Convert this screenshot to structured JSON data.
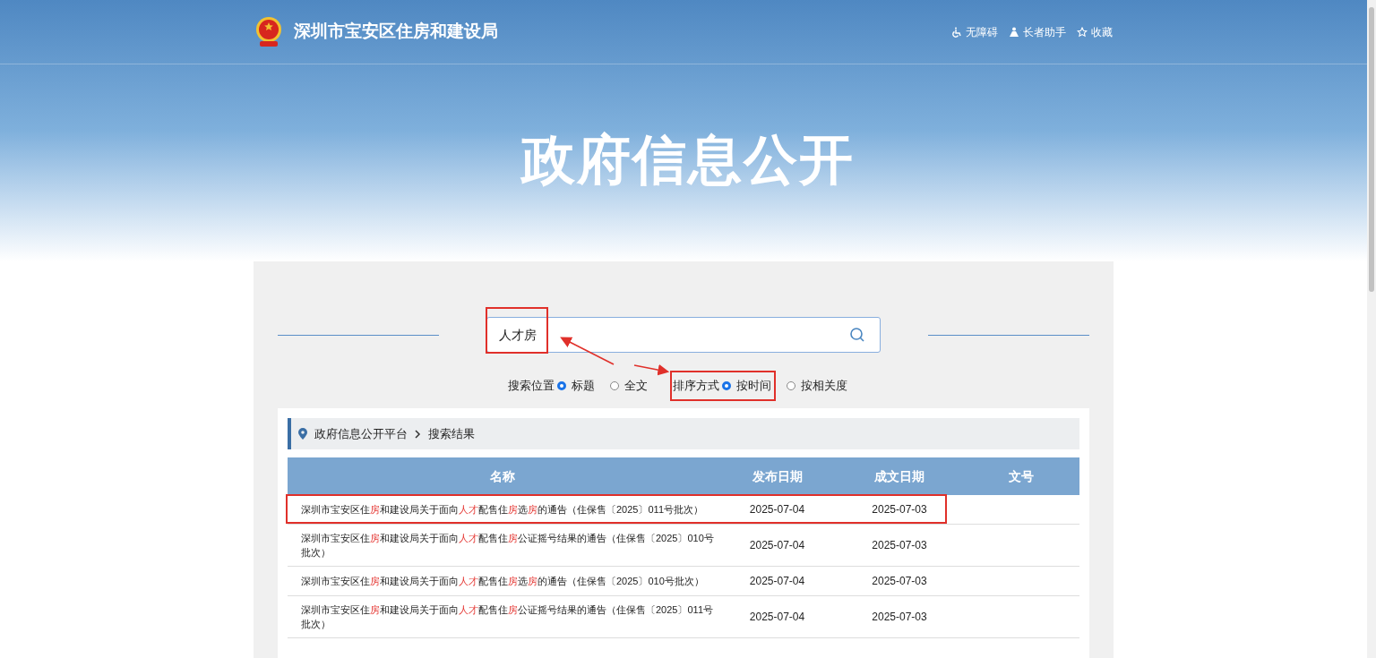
{
  "header": {
    "site_title": "深圳市宝安区住房和建设局",
    "links": [
      {
        "kind": "accessibility",
        "label": "无障碍"
      },
      {
        "kind": "elder",
        "label": "长者助手"
      },
      {
        "kind": "favorite",
        "label": "收藏"
      }
    ]
  },
  "banner": {
    "title": "政府信息公开"
  },
  "search": {
    "value": "人才房",
    "marked": true
  },
  "filters": [
    {
      "label": "搜索位置",
      "marked": false,
      "options": [
        {
          "label": "标题",
          "selected": true
        },
        {
          "label": "全文",
          "selected": false
        }
      ]
    },
    {
      "label": "排序方式",
      "marked": true,
      "options": [
        {
          "label": "按时间",
          "selected": true
        },
        {
          "label": "按相关度",
          "selected": false
        }
      ]
    }
  ],
  "breadcrumb": [
    "政府信息公开平台",
    "搜索结果"
  ],
  "table": {
    "columns": [
      "名称",
      "发布日期",
      "成文日期",
      "文号"
    ],
    "rows": [
      {
        "marked": true,
        "title": [
          {
            "text": "深圳市宝安区住",
            "hl": false
          },
          {
            "text": "房",
            "hl": true
          },
          {
            "text": "和建设局关于面向",
            "hl": false
          },
          {
            "text": "人才",
            "hl": true
          },
          {
            "text": "配售住",
            "hl": false
          },
          {
            "text": "房",
            "hl": true
          },
          {
            "text": "选",
            "hl": false
          },
          {
            "text": "房",
            "hl": true
          },
          {
            "text": "的通告（住保售〔2025〕011号批次）",
            "hl": false
          }
        ],
        "published": "2025-07-04",
        "written": "2025-07-03"
      },
      {
        "marked": false,
        "title": [
          {
            "text": "深圳市宝安区住",
            "hl": false
          },
          {
            "text": "房",
            "hl": true
          },
          {
            "text": "和建设局关于面向",
            "hl": false
          },
          {
            "text": "人才",
            "hl": true
          },
          {
            "text": "配售住",
            "hl": false
          },
          {
            "text": "房",
            "hl": true
          },
          {
            "text": "公证摇号结果的通告（住保售〔2025〕010号批次）",
            "hl": false
          }
        ],
        "published": "2025-07-04",
        "written": "2025-07-03"
      },
      {
        "marked": false,
        "title": [
          {
            "text": "深圳市宝安区住",
            "hl": false
          },
          {
            "text": "房",
            "hl": true
          },
          {
            "text": "和建设局关于面向",
            "hl": false
          },
          {
            "text": "人才",
            "hl": true
          },
          {
            "text": "配售住",
            "hl": false
          },
          {
            "text": "房",
            "hl": true
          },
          {
            "text": "选",
            "hl": false
          },
          {
            "text": "房",
            "hl": true
          },
          {
            "text": "的通告（住保售〔2025〕010号批次）",
            "hl": false
          }
        ],
        "published": "2025-07-04",
        "written": "2025-07-03"
      },
      {
        "marked": false,
        "title": [
          {
            "text": "深圳市宝安区住",
            "hl": false
          },
          {
            "text": "房",
            "hl": true
          },
          {
            "text": "和建设局关于面向",
            "hl": false
          },
          {
            "text": "人才",
            "hl": true
          },
          {
            "text": "配售住",
            "hl": false
          },
          {
            "text": "房",
            "hl": true
          },
          {
            "text": "公证摇号结果的通告（住保售〔2025〕011号批次）",
            "hl": false
          }
        ],
        "published": "2025-07-04",
        "written": "2025-07-03"
      }
    ]
  }
}
